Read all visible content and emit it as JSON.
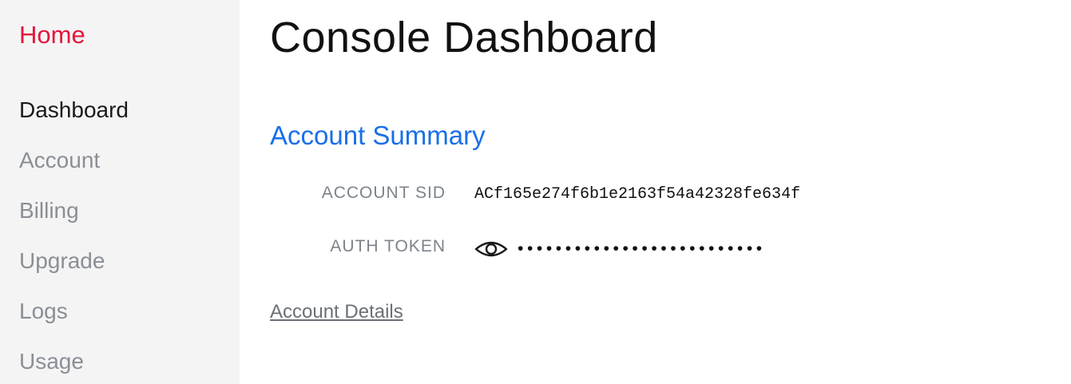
{
  "sidebar": {
    "home_label": "Home",
    "items": [
      {
        "label": "Dashboard",
        "active": true
      },
      {
        "label": "Account",
        "active": false
      },
      {
        "label": "Billing",
        "active": false
      },
      {
        "label": "Upgrade",
        "active": false
      },
      {
        "label": "Logs",
        "active": false
      },
      {
        "label": "Usage",
        "active": false
      }
    ]
  },
  "main": {
    "page_title": "Console Dashboard",
    "section_title": "Account Summary",
    "account_sid_label": "ACCOUNT SID",
    "account_sid_value": "ACf165e274f6b1e2163f54a42328fe634f",
    "auth_token_label": "AUTH TOKEN",
    "auth_token_icon": "eye-icon",
    "auth_token_masked": "••••••••••••••••••••••••••",
    "details_link": "Account Details"
  },
  "colors": {
    "brand_red": "#e4173d",
    "link_blue": "#1a6fe8",
    "sidebar_bg": "#f4f4f4"
  }
}
